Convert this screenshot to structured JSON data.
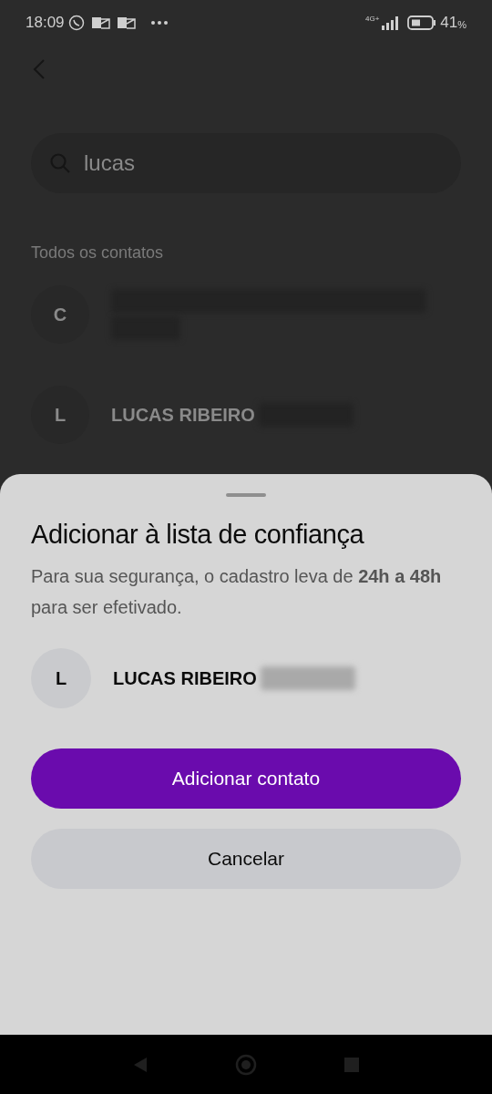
{
  "status_bar": {
    "time": "18:09",
    "network": "4G+",
    "battery": "41",
    "battery_unit": "%"
  },
  "search": {
    "value": "lucas"
  },
  "section_title": "Todos os contatos",
  "contacts": [
    {
      "initial": "C"
    },
    {
      "initial": "L",
      "name": "LUCAS RIBEIRO"
    }
  ],
  "sheet": {
    "title": "Adicionar à lista de confiança",
    "message": "Para sua segurança, o cadastro leva de **24h a 48h** para ser efetivado.",
    "contact": {
      "initial": "L",
      "name": "LUCAS RIBEIRO"
    },
    "primary_button": "Adicionar contato",
    "secondary_button": "Cancelar"
  }
}
